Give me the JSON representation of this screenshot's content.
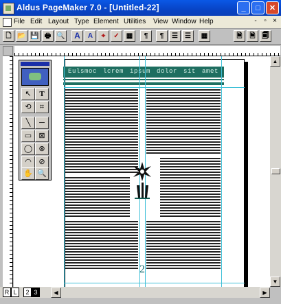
{
  "window": {
    "title": "Aldus PageMaker 7.0 - [Untitled-22]",
    "controls": {
      "minimize": "_",
      "maximize": "□",
      "close": "✕"
    }
  },
  "menubar": {
    "items": [
      "File",
      "Edit",
      "Layout",
      "Type",
      "Element",
      "Utilities",
      "View",
      "Window",
      "Help"
    ],
    "mdi_controls": [
      "-",
      "▫",
      "×"
    ]
  },
  "toolbar": {
    "buttons": [
      {
        "name": "new-icon",
        "glyph": "🗋"
      },
      {
        "name": "open-icon",
        "glyph": "📂"
      },
      {
        "name": "save-icon",
        "glyph": "💾"
      },
      {
        "name": "print-icon",
        "glyph": "🖶"
      },
      {
        "name": "find-icon",
        "glyph": "🔍"
      },
      {
        "name": "type-a-icon",
        "glyph": "A"
      },
      {
        "name": "type-a-small-icon",
        "glyph": "A"
      },
      {
        "name": "anchor-icon",
        "glyph": "⌖"
      },
      {
        "name": "spell-icon",
        "glyph": "✓"
      },
      {
        "name": "frame-icon",
        "glyph": "▦"
      },
      {
        "name": "paragraph-icon",
        "glyph": "¶"
      },
      {
        "name": "paragraph-align-icon",
        "glyph": "¶"
      },
      {
        "name": "list-icon",
        "glyph": "☰"
      },
      {
        "name": "list-indent-icon",
        "glyph": "☰"
      },
      {
        "name": "grid-icon",
        "glyph": "▦"
      },
      {
        "name": "page-icon",
        "glyph": "🗎"
      },
      {
        "name": "page-layout-icon",
        "glyph": "🗎"
      },
      {
        "name": "page-spread-icon",
        "glyph": "🗐"
      }
    ]
  },
  "toolbox": {
    "tools": [
      "↖",
      "T",
      "⟲",
      "⌗",
      "╲",
      "─",
      "▭",
      "⊠",
      "◯",
      "⊗",
      "◠",
      "⊘",
      "✋",
      "🔍"
    ]
  },
  "document": {
    "banner_text": "Eulsmoc lcrem ipsum dolor sit amet",
    "page_number": "2"
  },
  "pages": {
    "tabs": [
      "R",
      "L",
      "2",
      "3"
    ],
    "active": "3"
  },
  "colors": {
    "accent_green": "#1e6e60",
    "guide": "#3fc0d8",
    "title_blue": "#0844c6"
  }
}
